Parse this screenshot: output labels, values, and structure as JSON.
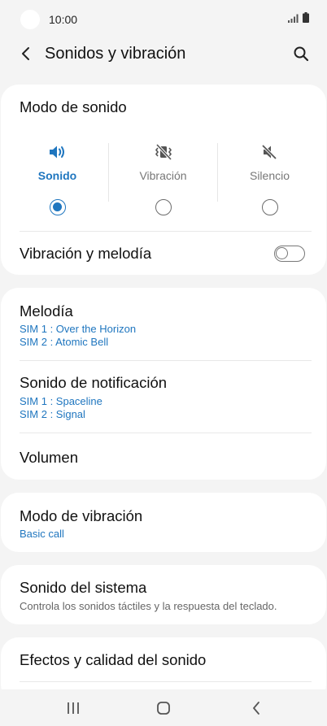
{
  "status_bar": {
    "time": "10:00"
  },
  "header": {
    "title": "Sonidos y vibración"
  },
  "sound_mode": {
    "title": "Modo de sonido",
    "options": [
      {
        "label": "Sonido",
        "icon": "volume-icon",
        "selected": true
      },
      {
        "label": "Vibración",
        "icon": "vibrate-icon",
        "selected": false
      },
      {
        "label": "Silencio",
        "icon": "mute-icon",
        "selected": false
      }
    ],
    "vibration_melody": {
      "label": "Vibración y melodía",
      "enabled": false
    }
  },
  "ringtone": {
    "title": "Melodía",
    "sim1": "SIM 1 : Over the Horizon",
    "sim2": "SIM 2 : Atomic Bell"
  },
  "notification_sound": {
    "title": "Sonido de notificación",
    "sim1": "SIM 1 : Spaceline",
    "sim2": "SIM 2 : Signal"
  },
  "volume": {
    "title": "Volumen"
  },
  "vibration_mode": {
    "title": "Modo de vibración",
    "value": "Basic call"
  },
  "system_sound": {
    "title": "Sonido del sistema",
    "description": "Controla los sonidos táctiles y la respuesta del teclado."
  },
  "sound_effects": {
    "title": "Efectos y calidad del sonido"
  },
  "colors": {
    "accent": "#1f76bf",
    "background": "#f4f4f4",
    "card": "#ffffff"
  }
}
